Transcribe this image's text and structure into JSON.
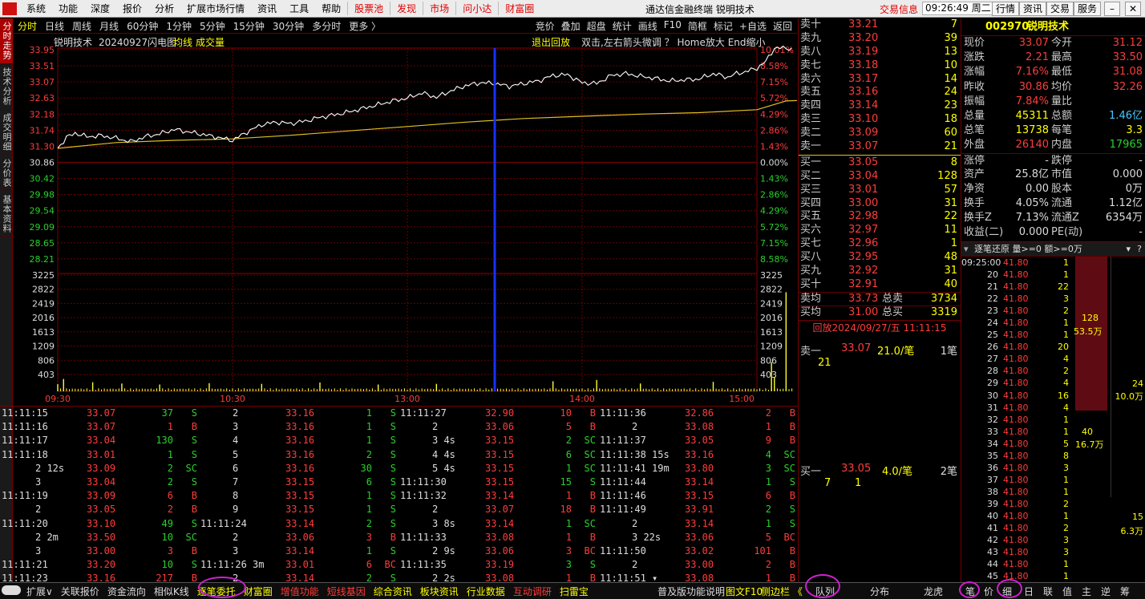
{
  "menubar": {
    "items": [
      "系统",
      "功能",
      "深度",
      "报价",
      "分析",
      "扩展市场行情",
      "资讯",
      "工具",
      "帮助"
    ],
    "red_items": [
      "股票池",
      "发现",
      "市场",
      "问小达",
      "财富圈"
    ],
    "title": "通达信金融终端  锐明技术",
    "trade": "交易信息",
    "time": "09:26:49 周二",
    "right_buttons": [
      "行情",
      "资讯",
      "交易",
      "服务"
    ]
  },
  "left_tabs": [
    "分时走势",
    "技术分析",
    "成交明细",
    "分价表",
    "基本资料"
  ],
  "period": {
    "tabs": [
      "分时",
      "日线",
      "周线",
      "月线",
      "60分钟",
      "1分钟",
      "5分钟",
      "15分钟",
      "30分钟",
      "多分时",
      "更多 〉"
    ],
    "tools": [
      "竞价",
      "叠加",
      "超盘",
      "统计",
      "画线",
      "F10",
      "简框",
      "标记",
      "+自选",
      "返回"
    ]
  },
  "chart_head": {
    "name": "锐明技术",
    "flash": "20240927闪电图",
    "avg": "均线",
    "vol": "成交量",
    "exit": "退出回放",
    "hint": "双击,左右箭头微调  ？  Home放大 End缩小"
  },
  "chart_data": {
    "type": "line",
    "title": "锐明技术 20240927闪电图",
    "price_ticks": [
      "33.95",
      "33.51",
      "33.07",
      "32.63",
      "32.18",
      "31.74",
      "31.30",
      "30.86",
      "30.42",
      "29.98",
      "29.54",
      "29.09",
      "28.65",
      "28.21"
    ],
    "pct_ticks": [
      "10.01%",
      "8.58%",
      "7.15%",
      "5.72%",
      "4.29%",
      "2.86%",
      "1.43%",
      "0.00%",
      "1.43%",
      "2.86%",
      "4.29%",
      "5.72%",
      "7.15%",
      "8.58%"
    ],
    "vol_ticks": [
      "3225",
      "2822",
      "2419",
      "2016",
      "1613",
      "1209",
      "806",
      "403"
    ],
    "x_ticks": [
      "09:30",
      "10:30",
      "13:00",
      "14:00",
      "15:00"
    ],
    "prev_close": 30.86,
    "ylim": [
      27.77,
      33.95
    ],
    "vol_max": 3628,
    "cursor_minute": 150,
    "price": [
      [
        0,
        31.2
      ],
      [
        3,
        31.5
      ],
      [
        6,
        31.62
      ],
      [
        10,
        31.52
      ],
      [
        15,
        31.55
      ],
      [
        20,
        31.48
      ],
      [
        25,
        31.38
      ],
      [
        30,
        31.52
      ],
      [
        35,
        31.6
      ],
      [
        40,
        31.72
      ],
      [
        45,
        31.65
      ],
      [
        50,
        31.58
      ],
      [
        55,
        31.5
      ],
      [
        60,
        31.42
      ],
      [
        65,
        31.65
      ],
      [
        70,
        31.85
      ],
      [
        75,
        31.92
      ],
      [
        80,
        31.88
      ],
      [
        85,
        31.95
      ],
      [
        90,
        32.05
      ],
      [
        95,
        32.12
      ],
      [
        100,
        32.2
      ],
      [
        105,
        32.3
      ],
      [
        110,
        32.4
      ],
      [
        115,
        32.5
      ],
      [
        120,
        32.58
      ],
      [
        125,
        32.72
      ],
      [
        130,
        32.6
      ],
      [
        135,
        32.78
      ],
      [
        140,
        32.92
      ],
      [
        145,
        33.0
      ],
      [
        150,
        32.98
      ],
      [
        155,
        32.9
      ],
      [
        160,
        32.98
      ],
      [
        165,
        33.05
      ],
      [
        170,
        33.2
      ],
      [
        175,
        33.22
      ],
      [
        180,
        33.0
      ],
      [
        185,
        32.98
      ],
      [
        190,
        33.2
      ],
      [
        195,
        33.25
      ],
      [
        200,
        33.18
      ],
      [
        205,
        33.12
      ],
      [
        210,
        33.05
      ],
      [
        215,
        33.08
      ],
      [
        220,
        33.1
      ],
      [
        225,
        33.25
      ],
      [
        230,
        33.15
      ],
      [
        233,
        33.25
      ],
      [
        236,
        33.3
      ],
      [
        240,
        33.4
      ],
      [
        243,
        33.58
      ],
      [
        246,
        33.95
      ],
      [
        252,
        33.95
      ]
    ],
    "avg": [
      [
        0,
        31.2
      ],
      [
        20,
        31.36
      ],
      [
        40,
        31.42
      ],
      [
        60,
        31.46
      ],
      [
        80,
        31.56
      ],
      [
        100,
        31.68
      ],
      [
        120,
        31.8
      ],
      [
        140,
        31.92
      ],
      [
        160,
        32.02
      ],
      [
        180,
        32.08
      ],
      [
        200,
        32.14
      ],
      [
        220,
        32.18
      ],
      [
        240,
        32.26
      ],
      [
        250,
        32.5
      ],
      [
        270,
        32.56
      ],
      [
        300,
        32.58
      ],
      [
        330,
        32.62
      ],
      [
        360,
        32.64
      ]
    ],
    "vol_spikes": [
      [
        0,
        220
      ],
      [
        2,
        380
      ],
      [
        12,
        280
      ],
      [
        22,
        240
      ],
      [
        35,
        210
      ],
      [
        52,
        250
      ],
      [
        70,
        230
      ],
      [
        90,
        270
      ],
      [
        110,
        210
      ],
      [
        130,
        230
      ],
      [
        150,
        260
      ],
      [
        170,
        310
      ],
      [
        185,
        350
      ],
      [
        200,
        240
      ],
      [
        225,
        290
      ],
      [
        245,
        900
      ],
      [
        250,
        3050
      ],
      [
        246,
        440
      ]
    ],
    "vol_base": 95
  },
  "ticker": [
    [
      [
        "11:11:15",
        "33.07",
        "37",
        "S",
        "2"
      ],
      [
        "11:11:16",
        "33.07",
        "1",
        "B",
        "3"
      ],
      [
        "11:11:17",
        "33.04",
        "130",
        "S",
        "4"
      ],
      [
        "11:11:18",
        "33.01",
        "1",
        "S",
        "5"
      ],
      [
        "2 12s",
        "33.09",
        "2",
        "SC",
        "6"
      ],
      [
        "3",
        "33.04",
        "2",
        "S",
        "7"
      ],
      [
        "11:11:19",
        "33.09",
        "6",
        "B",
        "8"
      ],
      [
        "2",
        "33.05",
        "2",
        "B",
        "9"
      ],
      [
        "11:11:20",
        "33.10",
        "49",
        "S",
        "11:11:24"
      ],
      [
        "2 2m",
        "33.50",
        "10",
        "SC",
        "2"
      ],
      [
        "3",
        "33.00",
        "3",
        "B",
        "3"
      ],
      [
        "11:11:21",
        "33.20",
        "10",
        "S",
        "11:11:26 3m"
      ],
      [
        "11:11:23",
        "33.16",
        "217",
        "B",
        "2"
      ]
    ],
    [
      [
        "33.16",
        "1",
        "S",
        "11:11:27"
      ],
      [
        "33.16",
        "1",
        "S",
        "2"
      ],
      [
        "33.16",
        "1",
        "S",
        "3 4s"
      ],
      [
        "33.16",
        "2",
        "S",
        "4 4s"
      ],
      [
        "33.16",
        "30",
        "S",
        "5 4s"
      ],
      [
        "33.15",
        "6",
        "S",
        "11:11:30"
      ],
      [
        "33.15",
        "1",
        "S",
        "11:11:32"
      ],
      [
        "33.15",
        "1",
        "S",
        "2"
      ],
      [
        "33.14",
        "2",
        "S",
        "3 8s"
      ],
      [
        "33.06",
        "3",
        "B",
        "11:11:33"
      ],
      [
        "33.14",
        "1",
        "S",
        "2 9s"
      ],
      [
        "33.01",
        "6",
        "BC",
        "11:11:35"
      ],
      [
        "33.14",
        "2",
        "S",
        "2 2s"
      ]
    ],
    [
      [
        "32.90",
        "10",
        "B",
        "11:11:36"
      ],
      [
        "33.06",
        "5",
        "B",
        "2"
      ],
      [
        "33.15",
        "2",
        "SC",
        "11:11:37"
      ],
      [
        "33.15",
        "6",
        "SC",
        "11:11:38 15s"
      ],
      [
        "33.15",
        "1",
        "SC",
        "11:11:41 19m"
      ],
      [
        "33.15",
        "15",
        "S",
        "11:11:44"
      ],
      [
        "33.14",
        "1",
        "B",
        "11:11:46"
      ],
      [
        "33.07",
        "18",
        "B",
        "11:11:49"
      ],
      [
        "33.14",
        "1",
        "SC",
        "2"
      ],
      [
        "33.08",
        "1",
        "B",
        "3 22s"
      ],
      [
        "33.06",
        "3",
        "BC",
        "11:11:50"
      ],
      [
        "33.19",
        "3",
        "S",
        "2"
      ],
      [
        "33.08",
        "1",
        "B",
        "11:11:51 ▾"
      ]
    ],
    [
      [
        "32.86",
        "2",
        "B"
      ],
      [
        "33.08",
        "1",
        "B"
      ],
      [
        "33.05",
        "9",
        "B"
      ],
      [
        "33.16",
        "4",
        "SC"
      ],
      [
        "33.80",
        "3",
        "SC"
      ],
      [
        "33.14",
        "1",
        "S"
      ],
      [
        "33.15",
        "6",
        "B"
      ],
      [
        "33.91",
        "2",
        "S"
      ],
      [
        "33.14",
        "1",
        "S"
      ],
      [
        "33.06",
        "5",
        "BC"
      ],
      [
        "33.02",
        "101",
        "B"
      ],
      [
        "33.00",
        "2",
        "B"
      ],
      [
        "33.08",
        "1",
        "B"
      ]
    ]
  ],
  "quote": {
    "sell": [
      [
        "卖十",
        "33.21",
        "7"
      ],
      [
        "卖九",
        "33.20",
        "39"
      ],
      [
        "卖八",
        "33.19",
        "13"
      ],
      [
        "卖七",
        "33.18",
        "10"
      ],
      [
        "卖六",
        "33.17",
        "14"
      ],
      [
        "卖五",
        "33.16",
        "24"
      ],
      [
        "卖四",
        "33.14",
        "23"
      ],
      [
        "卖三",
        "33.10",
        "18"
      ],
      [
        "卖二",
        "33.09",
        "60"
      ],
      [
        "卖一",
        "33.07",
        "21"
      ]
    ],
    "buy": [
      [
        "买一",
        "33.05",
        "8"
      ],
      [
        "买二",
        "33.04",
        "128"
      ],
      [
        "买三",
        "33.01",
        "57"
      ],
      [
        "买四",
        "33.00",
        "31"
      ],
      [
        "买五",
        "32.98",
        "22"
      ],
      [
        "买六",
        "32.97",
        "11"
      ],
      [
        "买七",
        "32.96",
        "1"
      ],
      [
        "买八",
        "32.95",
        "48"
      ],
      [
        "买九",
        "32.92",
        "31"
      ],
      [
        "买十",
        "32.91",
        "40"
      ]
    ],
    "avg_sell": [
      "卖均",
      "33.73",
      "总卖",
      "3734"
    ],
    "avg_buy": [
      "买均",
      "31.00",
      "总买",
      "3319"
    ]
  },
  "queue": {
    "title": "回放2024/09/27/五  11:11:15",
    "sell1": [
      "卖一",
      "33.07",
      "21.0/笔",
      "1笔"
    ],
    "sell1_items": [
      "21"
    ],
    "buy1": [
      "买一",
      "33.05",
      "4.0/笔",
      "2笔"
    ],
    "buy1_items": [
      "7",
      "1"
    ]
  },
  "info": {
    "code": "002970",
    "name": "锐明技术",
    "rows": [
      [
        "现价",
        "33.07",
        "今开",
        "31.12"
      ],
      [
        "涨跌",
        "2.21",
        "最高",
        "33.50"
      ],
      [
        "涨幅",
        "7.16%",
        "最低",
        "31.08"
      ],
      [
        "昨收",
        "30.86",
        "均价",
        "32.26"
      ],
      [
        "振幅",
        "7.84%",
        "量比",
        ""
      ],
      [
        "总量",
        "45311",
        "总额",
        "1.46亿"
      ],
      [
        "总笔",
        "13738",
        "每笔",
        "3.3"
      ],
      [
        "外盘",
        "26140",
        "内盘",
        "17965"
      ],
      [
        "涨停",
        "-",
        "跌停",
        "-"
      ],
      [
        "资产",
        "25.8亿",
        "市值",
        "0.000"
      ],
      [
        "净资",
        "0.00",
        "股本",
        "0万"
      ],
      [
        "换手",
        "4.05%",
        "流通",
        "1.12亿"
      ],
      [
        "换手Z",
        "7.13%",
        "流通Z",
        "6354万"
      ],
      [
        "收益(二)",
        "0.000",
        "PE(动)",
        "-"
      ]
    ]
  },
  "detail": {
    "head": "逐笔还原  量>=0 额>=0万",
    "rows": [
      [
        "09:25:00",
        "41.80",
        "1"
      ],
      [
        "20",
        "41.80",
        "1"
      ],
      [
        "21",
        "41.80",
        "22"
      ],
      [
        "22",
        "41.80",
        "3"
      ],
      [
        "23",
        "41.80",
        "2"
      ],
      [
        "24",
        "41.80",
        "1"
      ],
      [
        "25",
        "41.80",
        "1"
      ],
      [
        "26",
        "41.80",
        "20"
      ],
      [
        "27",
        "41.80",
        "4"
      ],
      [
        "28",
        "41.80",
        "2"
      ],
      [
        "29",
        "41.80",
        "4"
      ],
      [
        "30",
        "41.80",
        "16"
      ],
      [
        "31",
        "41.80",
        "4"
      ],
      [
        "32",
        "41.80",
        "1"
      ],
      [
        "33",
        "41.80",
        "1"
      ],
      [
        "34",
        "41.80",
        "5"
      ],
      [
        "35",
        "41.80",
        "8"
      ],
      [
        "36",
        "41.80",
        "3"
      ],
      [
        "37",
        "41.80",
        "1"
      ],
      [
        "38",
        "41.80",
        "1"
      ],
      [
        "39",
        "41.80",
        "2"
      ],
      [
        "40",
        "41.80",
        "1"
      ],
      [
        "41",
        "41.80",
        "2"
      ],
      [
        "42",
        "41.80",
        "3"
      ],
      [
        "43",
        "41.80",
        "3"
      ],
      [
        "44",
        "41.80",
        "1"
      ],
      [
        "45",
        "41.80",
        "1"
      ]
    ],
    "bar_labels": [
      "128",
      "53.5万",
      "24",
      "10.0万",
      "40",
      "16.7万",
      "15",
      "6.3万"
    ]
  },
  "bottom": {
    "items": [
      "扩展∨",
      "关联报价",
      "资金流向",
      "相似K线",
      "逐笔委托",
      "财富圈",
      "增值功能",
      "短线基因",
      "综合资讯",
      "板块资讯",
      "行业数据",
      "互动调研",
      "扫雷宝"
    ],
    "right": [
      "普及版功能说明",
      "图文F10",
      "侧边栏 《",
      "队列",
      "分布",
      "龙虎",
      "笔",
      "价",
      "细",
      "日",
      "联",
      "值",
      "主",
      "逆",
      "筹"
    ]
  }
}
